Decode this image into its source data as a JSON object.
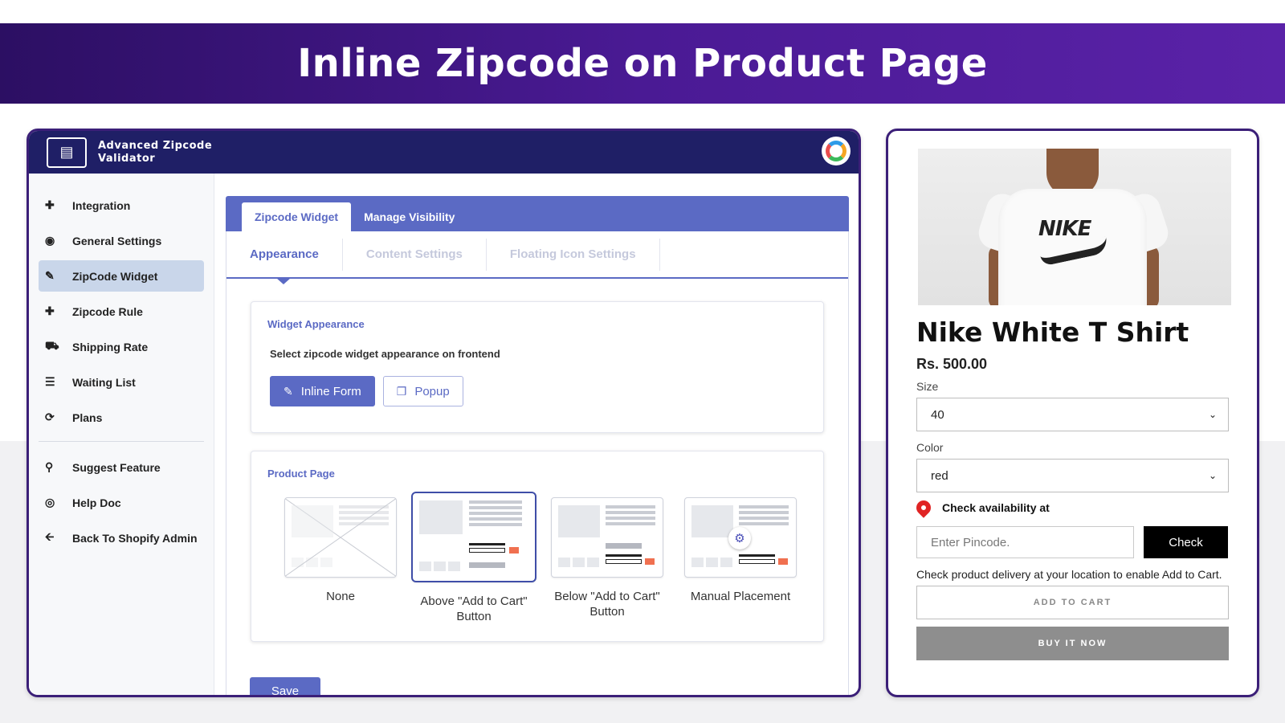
{
  "banner": {
    "title": "Inline Zipcode on Product Page"
  },
  "app": {
    "title": "Advanced Zipcode Validator"
  },
  "sidebar": {
    "items": [
      {
        "label": "Integration",
        "icon": "puzzle-icon"
      },
      {
        "label": "General Settings",
        "icon": "dashboard-icon"
      },
      {
        "label": "ZipCode Widget",
        "icon": "edit-icon",
        "active": true
      },
      {
        "label": "Zipcode Rule",
        "icon": "plus-icon"
      },
      {
        "label": "Shipping Rate",
        "icon": "truck-icon"
      },
      {
        "label": "Waiting List",
        "icon": "list-icon"
      },
      {
        "label": "Plans",
        "icon": "refresh-icon"
      }
    ],
    "bottom_items": [
      {
        "label": "Suggest Feature",
        "icon": "bulb-icon"
      },
      {
        "label": "Help Doc",
        "icon": "lifebuoy-icon"
      },
      {
        "label": "Back To Shopify Admin",
        "icon": "arrow-left-icon"
      }
    ]
  },
  "tabs": [
    {
      "label": "Zipcode Widget",
      "active": true
    },
    {
      "label": "Manage Visibility",
      "active": false
    }
  ],
  "subtabs": [
    {
      "label": "Appearance",
      "active": true
    },
    {
      "label": "Content Settings",
      "active": false
    },
    {
      "label": "Floating Icon Settings",
      "active": false
    }
  ],
  "widget_appearance": {
    "title": "Widget Appearance",
    "subtitle": "Select zipcode widget appearance on frontend",
    "options": [
      {
        "label": "Inline Form",
        "selected": true
      },
      {
        "label": "Popup",
        "selected": false
      }
    ]
  },
  "product_page": {
    "title": "Product Page",
    "placements": [
      {
        "label": "None",
        "selected": false
      },
      {
        "label": "Above \"Add to Cart\" Button",
        "selected": true
      },
      {
        "label": "Below \"Add to Cart\" Button",
        "selected": false
      },
      {
        "label": "Manual Placement",
        "selected": false
      }
    ]
  },
  "save_label": "Save",
  "product": {
    "image_brand_text": "NIKE",
    "name": "Nike White T Shirt",
    "price": "Rs. 500.00",
    "size_label": "Size",
    "size_value": "40",
    "color_label": "Color",
    "color_value": "red",
    "availability_label": "Check availability at",
    "pincode_placeholder": "Enter Pincode.",
    "check_label": "Check",
    "note": "Check product delivery at your location to enable Add to Cart.",
    "add_to_cart": "ADD TO CART",
    "buy_now": "BUY IT NOW"
  },
  "colors": {
    "banner": "#4a1a94",
    "header": "#1f1f66",
    "accent": "#5b6ac4",
    "check_button": "#000000",
    "buy_now": "#8e8e8e"
  }
}
